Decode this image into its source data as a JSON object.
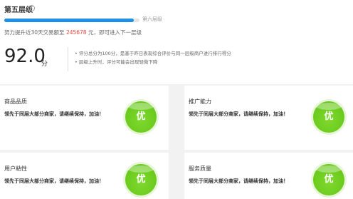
{
  "level": {
    "title": "第五层级",
    "help_icon": "question-circle-icon",
    "next_level_label": "第六层级",
    "progress": 0.96
  },
  "hint": {
    "prefix": "努力提升近30天交易额至",
    "amount": "245678",
    "suffix": "元，即可进入下一层级"
  },
  "score": {
    "value": "92.0",
    "unit": "分"
  },
  "notes": [
    "• 评分总分为100分，是基于昨日表现综合评价与同一层级商户进行排行得分",
    "• 层级上升时，评分可能会出现轻微下降"
  ],
  "cards": [
    {
      "title": "商品品质",
      "desc": "领先于同层大部分商家，请继续保持，加油！",
      "badge": "优"
    },
    {
      "title": "推广能力",
      "desc": "领先于同层大部分商家，请继续保持，加油！",
      "badge": "优"
    },
    {
      "title": "用户粘性",
      "desc": "领先于同层大部分商家，请继续保持，加油！",
      "badge": "优"
    },
    {
      "title": "服务质量",
      "desc": "领先于同层大部分商家，请继续保持，加油！",
      "badge": "优"
    }
  ],
  "colors": {
    "accent": "#1e90e6",
    "amount": "#e5463b",
    "badge": "#6ccc1e"
  }
}
